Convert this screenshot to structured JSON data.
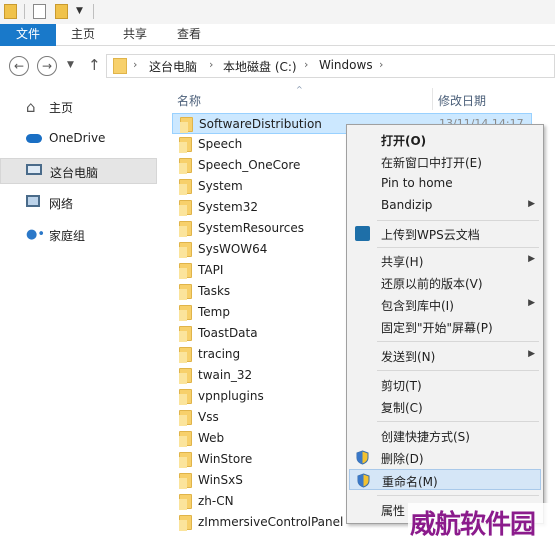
{
  "ribbon": {
    "tabs": [
      "文件",
      "主页",
      "共享",
      "查看"
    ]
  },
  "address": {
    "crumbs": [
      "这台电脑",
      "本地磁盘 (C:)",
      "Windows"
    ]
  },
  "nav": {
    "items": [
      "主页",
      "OneDrive",
      "这台电脑",
      "网络",
      "家庭组"
    ]
  },
  "columns": {
    "name": "名称",
    "date": "修改日期"
  },
  "files": [
    {
      "name": "SoftwareDistribution",
      "date": "13/11/14 14:17",
      "selected": true
    },
    {
      "name": "Speech"
    },
    {
      "name": "Speech_OneCore"
    },
    {
      "name": "System"
    },
    {
      "name": "System32"
    },
    {
      "name": "SystemResources"
    },
    {
      "name": "SysWOW64"
    },
    {
      "name": "TAPI"
    },
    {
      "name": "Tasks"
    },
    {
      "name": "Temp"
    },
    {
      "name": "ToastData"
    },
    {
      "name": "tracing"
    },
    {
      "name": "twain_32"
    },
    {
      "name": "vpnplugins"
    },
    {
      "name": "Vss"
    },
    {
      "name": "Web"
    },
    {
      "name": "WinStore"
    },
    {
      "name": "WinSxS"
    },
    {
      "name": "zh-CN"
    },
    {
      "name": "zImmersiveControlPanel"
    }
  ],
  "context_menu": {
    "open": "打开(O)",
    "open_new_window": "在新窗口中打开(E)",
    "pin_to_home": "Pin to home",
    "bandizip": "Bandizip",
    "upload_wps": "上传到WPS云文档",
    "share": "共享(H)",
    "restore_prev": "还原以前的版本(V)",
    "include_library": "包含到库中(I)",
    "pin_start": "固定到\"开始\"屏幕(P)",
    "send_to": "发送到(N)",
    "cut": "剪切(T)",
    "copy": "复制(C)",
    "create_shortcut": "创建快捷方式(S)",
    "delete": "删除(D)",
    "rename": "重命名(M)",
    "properties": "属性"
  },
  "watermark": "威航软件园",
  "colors": {
    "accent": "#1979ca",
    "selection": "#cce8ff",
    "watermark": "#8b1b8c"
  }
}
